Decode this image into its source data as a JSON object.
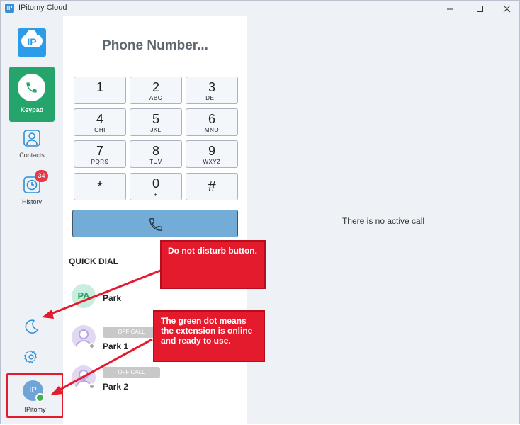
{
  "window": {
    "title": "IPitomy Cloud",
    "icon_text": "IP"
  },
  "nav": {
    "logo_text": "IP",
    "items": [
      {
        "label": "Keypad"
      },
      {
        "label": "Contacts"
      },
      {
        "label": "History",
        "badge": "34"
      }
    ],
    "user": {
      "initials": "IP",
      "name": "IPitomy",
      "status": "online"
    }
  },
  "keypad": {
    "display_placeholder": "Phone Number...",
    "keys": [
      {
        "digit": "1",
        "letters": ""
      },
      {
        "digit": "2",
        "letters": "ABC"
      },
      {
        "digit": "3",
        "letters": "DEF"
      },
      {
        "digit": "4",
        "letters": "GHI"
      },
      {
        "digit": "5",
        "letters": "JKL"
      },
      {
        "digit": "6",
        "letters": "MNO"
      },
      {
        "digit": "7",
        "letters": "PQRS"
      },
      {
        "digit": "8",
        "letters": "TUV"
      },
      {
        "digit": "9",
        "letters": "WXYZ"
      },
      {
        "digit": "*",
        "letters": ""
      },
      {
        "digit": "0",
        "letters": "+"
      },
      {
        "digit": "#",
        "letters": ""
      }
    ]
  },
  "quick_dial": {
    "title": "QUICK DIAL",
    "contacts": [
      {
        "initials": "PA",
        "name": "Park",
        "status": ""
      },
      {
        "initials": "",
        "name": "Park 1",
        "status": "OFF CALL"
      },
      {
        "initials": "",
        "name": "Park 2",
        "status": "OFF CALL"
      }
    ]
  },
  "main": {
    "empty_message": "There is no active call"
  },
  "annotations": {
    "dnd": "Do not disturb button.",
    "green_dot": "The green dot means the extension is online and ready to use."
  },
  "colors": {
    "accent_green": "#25a56b",
    "call_button": "#74acd8",
    "badge_red": "#e03a4b",
    "annotation_red": "#e41b2d",
    "online_dot": "#3ab54a"
  }
}
